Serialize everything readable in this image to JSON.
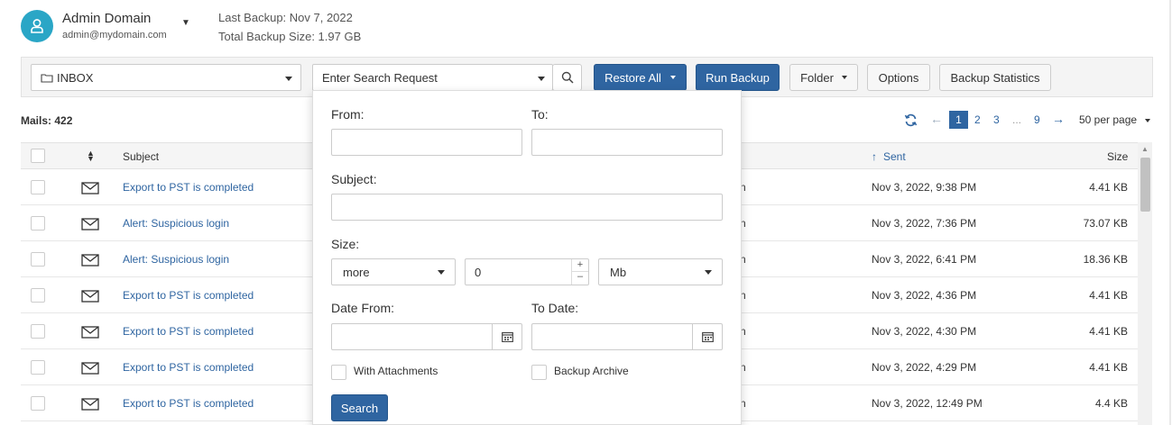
{
  "account": {
    "name": "Admin Domain",
    "email": "admin@mydomain.com",
    "last_backup": "Last Backup: Nov 7, 2022",
    "total_size": "Total Backup Size: 1.97 GB"
  },
  "toolbar": {
    "folder_select": "INBOX",
    "search_placeholder": "Enter Search Request",
    "restore_all": "Restore All",
    "run_backup": "Run Backup",
    "folder": "Folder",
    "options": "Options",
    "backup_statistics": "Backup Statistics"
  },
  "mails": {
    "count_label": "Mails: 422"
  },
  "pagination": {
    "pages": [
      "1",
      "2",
      "3",
      "...",
      "9"
    ],
    "current": "1",
    "per_page": "50 per page"
  },
  "table": {
    "headers": {
      "subject": "Subject",
      "sent": "Sent",
      "size": "Size"
    },
    "rows": [
      {
        "subject": "Export to PST is completed",
        "from_fragment": "n",
        "sent": "Nov 3, 2022, 9:38 PM",
        "size": "4.41 KB"
      },
      {
        "subject": "Alert: Suspicious login",
        "from_fragment": "n",
        "sent": "Nov 3, 2022, 7:36 PM",
        "size": "73.07 KB"
      },
      {
        "subject": "Alert: Suspicious login",
        "from_fragment": "n",
        "sent": "Nov 3, 2022, 6:41 PM",
        "size": "18.36 KB"
      },
      {
        "subject": "Export to PST is completed",
        "from_fragment": "n",
        "sent": "Nov 3, 2022, 4:36 PM",
        "size": "4.41 KB"
      },
      {
        "subject": "Export to PST is completed",
        "from_fragment": "n",
        "sent": "Nov 3, 2022, 4:30 PM",
        "size": "4.41 KB"
      },
      {
        "subject": "Export to PST is completed",
        "from_fragment": "n",
        "sent": "Nov 3, 2022, 4:29 PM",
        "size": "4.41 KB"
      },
      {
        "subject": "Export to PST is completed",
        "from_fragment": "n",
        "sent": "Nov 3, 2022, 12:49 PM",
        "size": "4.4 KB"
      }
    ]
  },
  "search_panel": {
    "from_label": "From:",
    "to_label": "To:",
    "subject_label": "Subject:",
    "size_label": "Size:",
    "size_comparator": "more",
    "size_value": "0",
    "size_unit": "Mb",
    "date_from_label": "Date From:",
    "to_date_label": "To Date:",
    "with_attachments": "With Attachments",
    "backup_archive": "Backup Archive",
    "search_button": "Search"
  },
  "colors": {
    "accent": "#2f65a1",
    "avatar": "#2aa6c6"
  }
}
